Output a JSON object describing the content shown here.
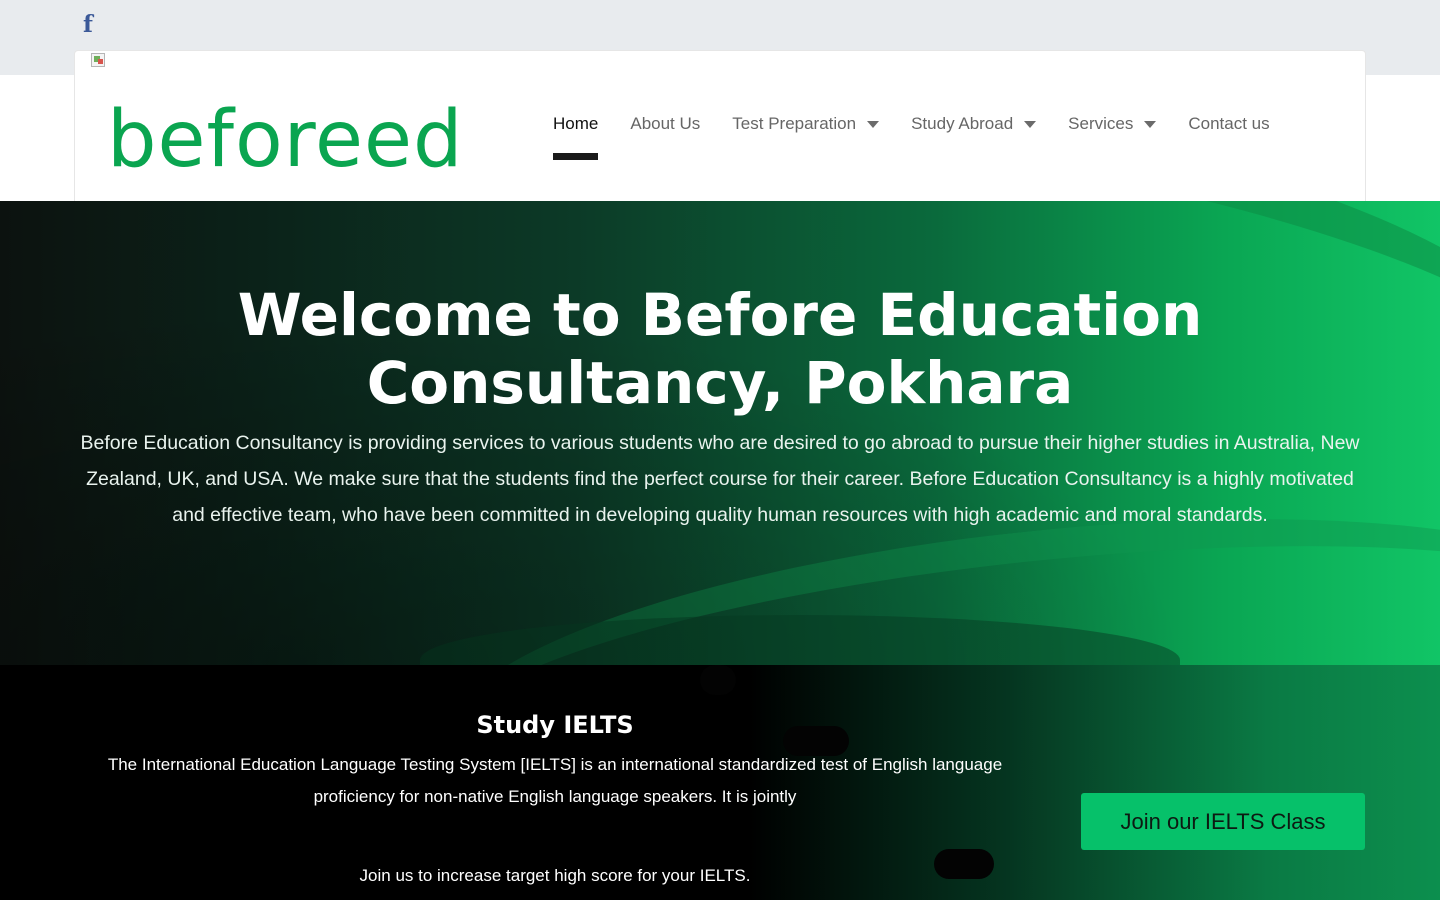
{
  "social": {
    "icon": "facebook-icon",
    "glyph": "f",
    "color": "#3b5998"
  },
  "brand": {
    "logo_text": "beforeed",
    "color": "#0aa550"
  },
  "nav": {
    "items": [
      {
        "label": "Home",
        "active": true,
        "dropdown": false
      },
      {
        "label": "About Us",
        "active": false,
        "dropdown": false
      },
      {
        "label": "Test Preparation",
        "active": false,
        "dropdown": true
      },
      {
        "label": "Study Abroad",
        "active": false,
        "dropdown": true
      },
      {
        "label": "Services",
        "active": false,
        "dropdown": true
      },
      {
        "label": "Contact us",
        "active": false,
        "dropdown": false
      }
    ]
  },
  "hero": {
    "title": "Welcome to Before Education Consultancy, Pokhara",
    "text": "Before Education Consultancy is providing services to various students who are desired to go abroad to pursue their higher studies in Australia, New Zealand, UK, and USA. We make sure that the students find the perfect course for their career. Before Education Consultancy is a highly motivated and effective team, who have been committed in developing quality human resources with high academic and moral standards."
  },
  "ielts": {
    "title": "Study IELTS",
    "text": "The International Education Language Testing System [IELTS] is an international standardized test of English language proficiency for non-native English language speakers. It is jointly",
    "cta_text": "Join us to increase target high score for your IELTS.",
    "button_label": "Join our IELTS Class",
    "button_color": "#06c16a"
  }
}
